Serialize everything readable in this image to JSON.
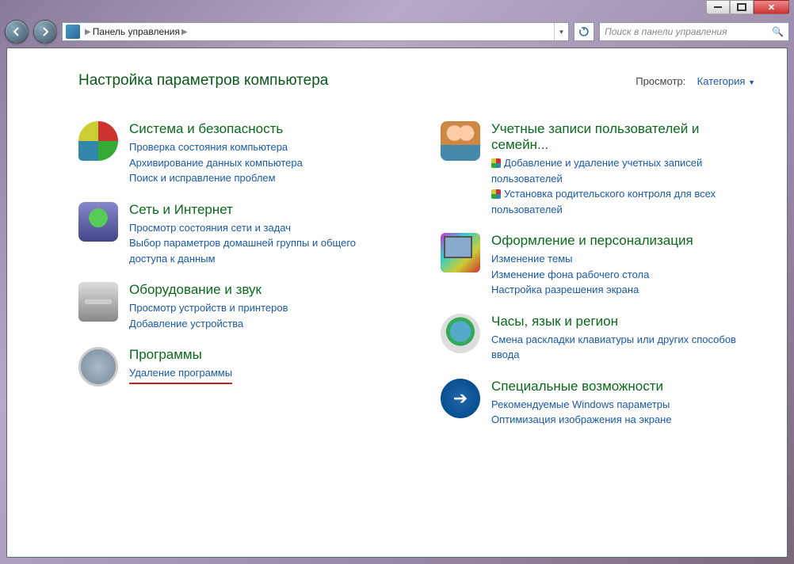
{
  "breadcrumb": {
    "root": "Панель управления"
  },
  "search": {
    "placeholder": "Поиск в панели управления"
  },
  "header": {
    "title": "Настройка параметров компьютера",
    "view_label": "Просмотр:",
    "view_value": "Категория"
  },
  "left": [
    {
      "title": "Система и безопасность",
      "links": [
        {
          "text": "Проверка состояния компьютера"
        },
        {
          "text": "Архивирование данных компьютера"
        },
        {
          "text": "Поиск и исправление проблем"
        }
      ]
    },
    {
      "title": "Сеть и Интернет",
      "links": [
        {
          "text": "Просмотр состояния сети и задач"
        },
        {
          "text": "Выбор параметров домашней группы и общего доступа к данным"
        }
      ]
    },
    {
      "title": "Оборудование и звук",
      "links": [
        {
          "text": "Просмотр устройств и принтеров"
        },
        {
          "text": "Добавление устройства"
        }
      ]
    },
    {
      "title": "Программы",
      "links": [
        {
          "text": "Удаление программы",
          "underlined": true
        }
      ]
    }
  ],
  "right": [
    {
      "title": "Учетные записи пользователей и семейн...",
      "links": [
        {
          "text": "Добавление и удаление учетных записей пользователей",
          "shield": true
        },
        {
          "text": "Установка родительского контроля для всех пользователей",
          "shield": true
        }
      ]
    },
    {
      "title": "Оформление и персонализация",
      "links": [
        {
          "text": "Изменение темы"
        },
        {
          "text": "Изменение фона рабочего стола"
        },
        {
          "text": "Настройка разрешения экрана"
        }
      ]
    },
    {
      "title": "Часы, язык и регион",
      "links": [
        {
          "text": "Смена раскладки клавиатуры или других способов ввода"
        }
      ]
    },
    {
      "title": "Специальные возможности",
      "links": [
        {
          "text": "Рекомендуемые Windows параметры"
        },
        {
          "text": "Оптимизация изображения на экране"
        }
      ]
    }
  ]
}
